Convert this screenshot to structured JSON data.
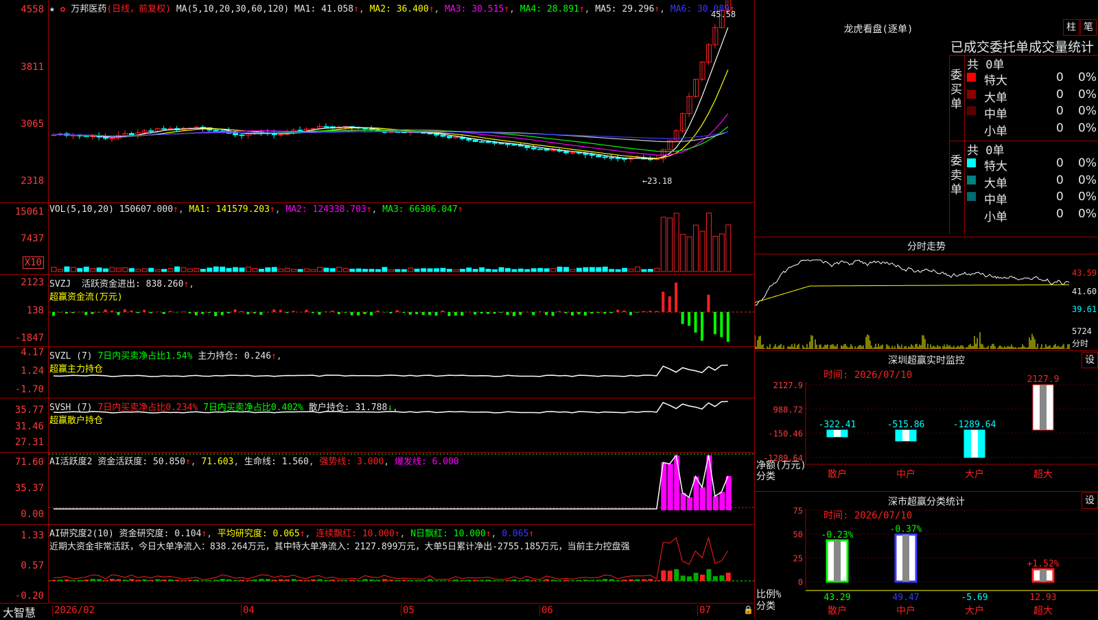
{
  "stock": {
    "name": "万邦医药",
    "mode": "(日线，前复权)",
    "ma_label": "MA(5,10,20,30,60,120)",
    "ma1": "MA1: 41.058",
    "ma2": "MA2: 36.400",
    "ma3": "MA3: 30.515",
    "ma4": "MA4: 28.891",
    "ma5": "MA5: 29.296",
    "ma6": "MA6: 30.089",
    "high_label": "45.58",
    "low_label": "←23.18",
    "ticks": [
      "4558",
      "3811",
      "3065",
      "2318"
    ]
  },
  "vol": {
    "label": "VOL(5,10,20)",
    "value": "150607.000",
    "ma1": "MA1: 141579.203",
    "ma2": "MA2: 124338.703",
    "ma3": "MA3: 66306.047",
    "ticks": [
      "15061",
      "7437"
    ],
    "unit": "X10"
  },
  "svzj": {
    "label": "SVZJ",
    "text1": "活跃资金进出: 838.260",
    "text2": "超赢资金流(万元)",
    "ticks": [
      "2123",
      "138",
      "-1847"
    ]
  },
  "svzl": {
    "label": "SVZL (7)",
    "t1": "7日内买卖净占比1.54%",
    "t2": "主力持仓: 0.246",
    "t3": "超赢主力持仓",
    "ticks": [
      "4.17",
      "1.24",
      "-1.70"
    ]
  },
  "svsh": {
    "label": "SVSH (7)",
    "t1": "7日内买卖净占比0.234%",
    "t2": "7日内买卖净占比0.402%",
    "t3": "散户持仓: 31.788",
    "t4": "超赢散户持仓",
    "ticks": [
      "35.77",
      "31.46",
      "27.31"
    ]
  },
  "ai1": {
    "label": "AI活跃度2",
    "t1": "资金活跃度: 50.850",
    "t2": "71.603",
    "t3": "生命线: 1.560",
    "t4": "强势线: 3.000",
    "t5": "爆发线: 6.000",
    "ticks": [
      "71.60",
      "35.37",
      "0.00"
    ]
  },
  "ai2": {
    "label": "AI研究度2(10)",
    "t1": "资金研究度: 0.104",
    "t2": "平均研究度: 0.065",
    "t3": "连续飘红: 10.000",
    "t4": "N日飘红: 10.000",
    "t5": "0.065",
    "summary": "近期大资金非常活跃，今日大单净流入：838.264万元，其中特大单净流入：2127.899万元，大单5日累计净出-2755.185万元，当前主力控盘强",
    "ticks": [
      "1.33",
      "0.57",
      "-0.20"
    ]
  },
  "bottom": {
    "brand": "大智慧",
    "dates": [
      "2026/02",
      "04",
      "05",
      "06",
      "07"
    ]
  },
  "lhb": {
    "title": "龙虎看盘(逐单)",
    "btn1": "柱",
    "btn2": "笔",
    "header": "已成交委托单成交量统计",
    "buy_label": "委买单",
    "sell_label": "委卖单",
    "buy_total": "共 0单",
    "sell_total": "共 0单",
    "buy_rows": [
      {
        "name": "特大",
        "v": "0",
        "p": "0%",
        "color": "#ff0000"
      },
      {
        "name": "大单",
        "v": "0",
        "p": "0%",
        "color": "#8b0000"
      },
      {
        "name": "中单",
        "v": "0",
        "p": "0%",
        "color": "#5a0000"
      },
      {
        "name": "小单",
        "v": "0",
        "p": "0%",
        "color": "#000000"
      }
    ],
    "sell_rows": [
      {
        "name": "特大",
        "v": "0",
        "p": "0%",
        "color": "#00ffff"
      },
      {
        "name": "大单",
        "v": "0",
        "p": "0%",
        "color": "#008080"
      },
      {
        "name": "中单",
        "v": "0",
        "p": "0%",
        "color": "#006c6c"
      },
      {
        "name": "小单",
        "v": "0",
        "p": "0%",
        "color": "#000000"
      }
    ]
  },
  "fs": {
    "title": "分时走势",
    "ticks": [
      "43.59",
      "41.60",
      "39.61"
    ],
    "vol_tick": "5724",
    "vol_label": "分时"
  },
  "mon": {
    "title": "深圳超赢实时监控",
    "btn": "设",
    "time": "时间: 2026/07/10",
    "ylabel1": "净额(万元)",
    "ylabel2": "分类",
    "ticks": [
      "2127.9",
      "988.72",
      "-150.46",
      "-1289.64"
    ],
    "bars": [
      {
        "cat": "散户",
        "value": -322.41,
        "label": "-322.41"
      },
      {
        "cat": "中户",
        "value": -515.86,
        "label": "-515.86"
      },
      {
        "cat": "大户",
        "value": -1289.64,
        "label": "-1289.64"
      },
      {
        "cat": "超大",
        "value": 2127.9,
        "label": "2127.9"
      }
    ]
  },
  "cls": {
    "title": "深市超赢分类统计",
    "btn": "设",
    "time": "时间: 2026/07/10",
    "ylabel1": "比例%",
    "ylabel2": "分类",
    "ticks": [
      "75",
      "50",
      "25",
      "0"
    ],
    "bars": [
      {
        "cat": "散户",
        "value": 43.29,
        "label": "43.29",
        "chg": "-0.23%"
      },
      {
        "cat": "中户",
        "value": 49.47,
        "label": "49.47",
        "chg": "-0.37%"
      },
      {
        "cat": "大户",
        "value": -5.69,
        "label": "-5.69",
        "chg": ""
      },
      {
        "cat": "超大",
        "value": 12.93,
        "label": "12.93",
        "chg": "+1.52%"
      }
    ]
  },
  "colors": {
    "border": "#a00000",
    "up": "#ff2020",
    "down": "#00ffff"
  }
}
